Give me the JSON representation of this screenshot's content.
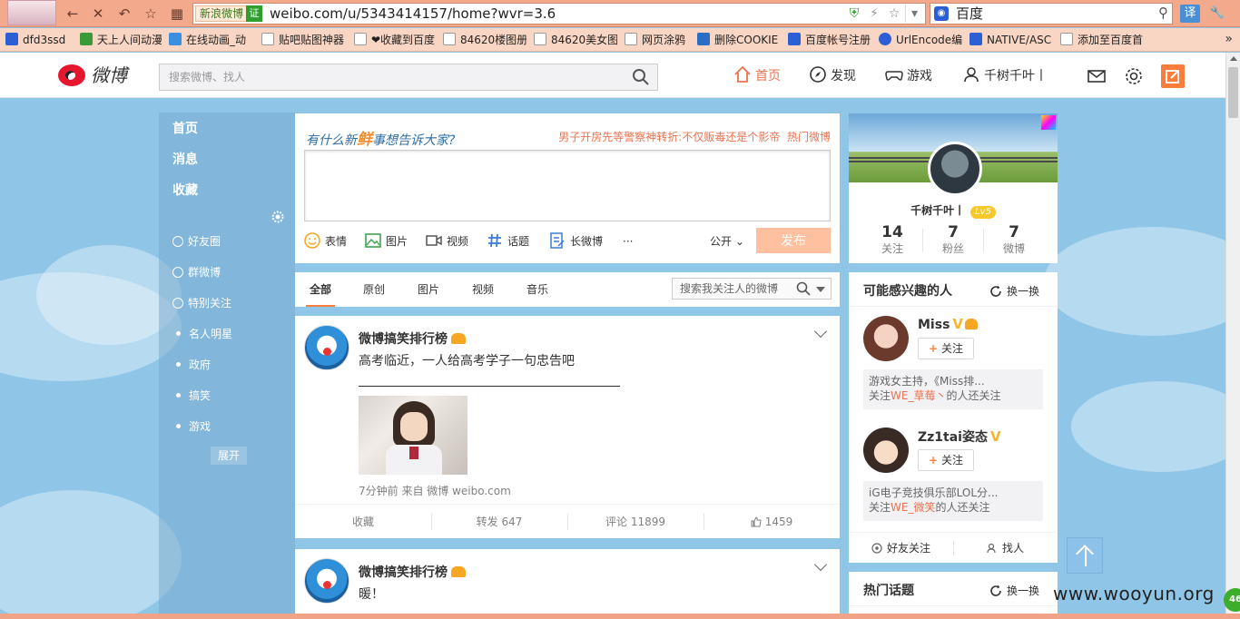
{
  "browser": {
    "site_chip": "新浪微博",
    "verify_badge": "证",
    "url": "weibo.com/u/5343414157/home?wvr=3.6",
    "search_engine": "百度",
    "translate_label": "译",
    "bookmarks": [
      {
        "label": "dfd3ssd",
        "icon": "paw-icon"
      },
      {
        "label": "天上人间动漫",
        "icon": "site-icon"
      },
      {
        "label": "在线动画_动",
        "icon": "site-icon"
      },
      {
        "label": "贴吧贴图神器",
        "icon": "page-icon"
      },
      {
        "label": "❤收藏到百度",
        "icon": "page-icon"
      },
      {
        "label": "84620楼图册",
        "icon": "page-icon"
      },
      {
        "label": "84620美女图",
        "icon": "page-icon"
      },
      {
        "label": "网页涂鸦",
        "icon": "page-icon"
      },
      {
        "label": "删除COOKIE",
        "icon": "shield-icon"
      },
      {
        "label": "百度帐号注册",
        "icon": "paw-icon"
      },
      {
        "label": "UrlEncode编",
        "icon": "globe-icon"
      },
      {
        "label": "NATIVE/ASC",
        "icon": "paw-icon"
      },
      {
        "label": "添加至百度首",
        "icon": "page-icon"
      }
    ],
    "bookmarks_more": "»"
  },
  "nav": {
    "logo_text": "微博",
    "search_placeholder": "搜索微博、找人",
    "items": {
      "home": "首页",
      "discover": "发现",
      "game": "游戏",
      "user": "千树千叶丨"
    }
  },
  "sidebar": {
    "main": [
      "首页",
      "消息",
      "收藏"
    ],
    "groups": [
      {
        "label": "好友圈",
        "icon": "circle"
      },
      {
        "label": "群微博",
        "icon": "circle"
      },
      {
        "label": "特别关注",
        "icon": "circle"
      },
      {
        "label": "名人明星",
        "icon": "dot"
      },
      {
        "label": "政府",
        "icon": "dot"
      },
      {
        "label": "搞笑",
        "icon": "dot"
      },
      {
        "label": "游戏",
        "icon": "dot"
      }
    ],
    "expand": "展开"
  },
  "publisher": {
    "prompt_pre": "有什么新",
    "prompt_highlight": "鲜",
    "prompt_post": "事想告诉大家?",
    "hot_text": "男子开房先等警察神转折:不仅贩毒还是个影帝",
    "hot_link": "热门微博",
    "tools": [
      "表情",
      "图片",
      "视频",
      "话题",
      "长微博",
      "···"
    ],
    "privacy": "公开",
    "send": "发布"
  },
  "feed_tabs": {
    "tabs": [
      "全部",
      "原创",
      "图片",
      "视频",
      "音乐"
    ],
    "search_placeholder": "搜索我关注人的微博"
  },
  "posts": [
    {
      "author": "微博搞笑排行榜",
      "text": "高考临近，一人给高考学子一句忠告吧",
      "meta": "7分钟前 来自 微博 weibo.com",
      "actions": {
        "fav": "收藏",
        "repost": "转发 647",
        "comment": "评论 11899",
        "like": "1459"
      }
    },
    {
      "author": "微博搞笑排行榜",
      "text": "暖！"
    }
  ],
  "profile": {
    "name": "千树千叶丨",
    "level": "Lv5",
    "stats": [
      {
        "num": "14",
        "label": "关注"
      },
      {
        "num": "7",
        "label": "粉丝"
      },
      {
        "num": "7",
        "label": "微博"
      }
    ]
  },
  "interest": {
    "title": "可能感兴趣的人",
    "refresh": "换一换",
    "people": [
      {
        "name": "Miss",
        "verified": "V",
        "follow": "关注",
        "reason_1": "游戏女主持，《Miss排...",
        "reason_2_pre": "关注",
        "reason_2_hl": "WE_草莓丶",
        "reason_2_post": "的人还关注"
      },
      {
        "name": "Zz1tai姿态",
        "verified": "V",
        "follow": "关注",
        "reason_1": "iG电子竞技俱乐部LOL分...",
        "reason_2_pre": "关注",
        "reason_2_hl": "WE_微笑",
        "reason_2_post": "的人还关注"
      }
    ],
    "bottom": [
      "好友关注",
      "找人"
    ]
  },
  "hot_topics": {
    "title": "热门话题",
    "refresh": "换一换"
  },
  "watermark": "www.wooyun.org",
  "badge": "46",
  "colors": {
    "accent": "#eb7350",
    "brand_red": "#e6162d",
    "link_blue": "#2e6ea6",
    "bg": "#8fc6e8"
  }
}
